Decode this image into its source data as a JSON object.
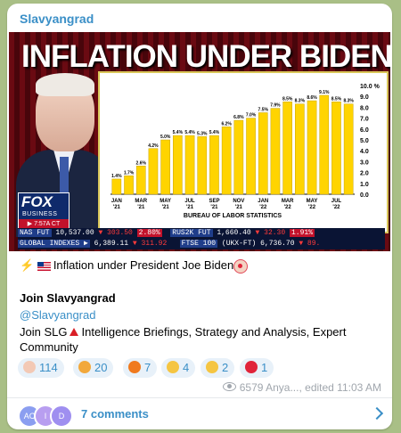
{
  "channel": {
    "name": "Slavyangrad"
  },
  "media": {
    "headline": "INFLATION UNDER BIDEN",
    "logo": {
      "network": "FOX",
      "sub": "BUSINESS",
      "time": "▶ 7:57A CT"
    },
    "ticker": {
      "row1": [
        "NAS FUT",
        "10,537.00",
        "▼ 303.50",
        "2.80%",
        "RUS2K FUT",
        "1,660.40",
        "▼ 32.30",
        "1.91%"
      ],
      "row2": [
        "GLOBAL INDEXES ▶",
        "6,389.11",
        "▼ 311.92",
        "FTSE 100",
        "(UKX-FT)",
        "6,736.70",
        "▼ 89."
      ]
    }
  },
  "chart_data": {
    "type": "bar",
    "categories": [
      "JAN '21",
      "FEB '21",
      "MAR '21",
      "APR '21",
      "MAY '21",
      "JUN '21",
      "JUL '21",
      "AUG '21",
      "SEP '21",
      "OCT '21",
      "NOV '21",
      "DEC '21",
      "JAN '22",
      "FEB '22",
      "MAR '22",
      "APR '22",
      "MAY '22",
      "JUN '22",
      "JUL '22",
      "AUG '22"
    ],
    "values": [
      1.4,
      1.7,
      2.6,
      4.2,
      5.0,
      5.4,
      5.4,
      5.3,
      5.4,
      6.2,
      6.8,
      7.0,
      7.5,
      7.9,
      8.5,
      8.3,
      8.6,
      9.1,
      8.5,
      8.3
    ],
    "x_tick_labels": [
      "JAN\n'21",
      "MAR\n'21",
      "MAY\n'21",
      "JUL\n'21",
      "SEP\n'21",
      "NOV\n'21",
      "JAN\n'22",
      "MAR\n'22",
      "MAY\n'22",
      "JUL\n'22"
    ],
    "y_ticks": [
      "10.0 %",
      "9.0",
      "8.0",
      "7.0",
      "6.0",
      "5.0",
      "4.0",
      "3.0",
      "2.0",
      "1.0",
      "0.0"
    ],
    "ylim": [
      0,
      10
    ],
    "source_label": "BUREAU OF LABOR STATISTICS",
    "colors": {
      "bar": "#ffd400",
      "bar_edge": "#c9a400"
    }
  },
  "post": {
    "line1_text": "Inflation under President Joe Biden",
    "join_title": "Join Slavyangrad",
    "join_link": "@Slavyangrad",
    "join_desc_a": "Join SLG",
    "join_desc_b": "Intelligence Briefings, Strategy and Analysis, Expert Community"
  },
  "reactions": [
    {
      "icon": "clown-icon",
      "count": "114",
      "color": "#f3c9b5"
    },
    {
      "icon": "party-popper-icon",
      "count": "20",
      "color": "#f2a83b"
    },
    {
      "icon": "fire-icon",
      "count": "7",
      "color": "#f07a1e"
    },
    {
      "icon": "clapping-hands-icon",
      "count": "4",
      "color": "#f5c542"
    },
    {
      "icon": "thumbs-up-icon",
      "count": "2",
      "color": "#f5c542"
    },
    {
      "icon": "heart-icon",
      "count": "1",
      "color": "#e0243a"
    }
  ],
  "meta": {
    "views": "6579",
    "author": "Anya...",
    "edited": "edited 11:03 AM"
  },
  "comments": {
    "label": "7 comments",
    "avatars": [
      {
        "initials": "AC",
        "color": "#8b9ef0"
      },
      {
        "initials": "I",
        "color": "#b89ef0"
      },
      {
        "initials": "D",
        "color": "#9f8ff0"
      }
    ]
  }
}
